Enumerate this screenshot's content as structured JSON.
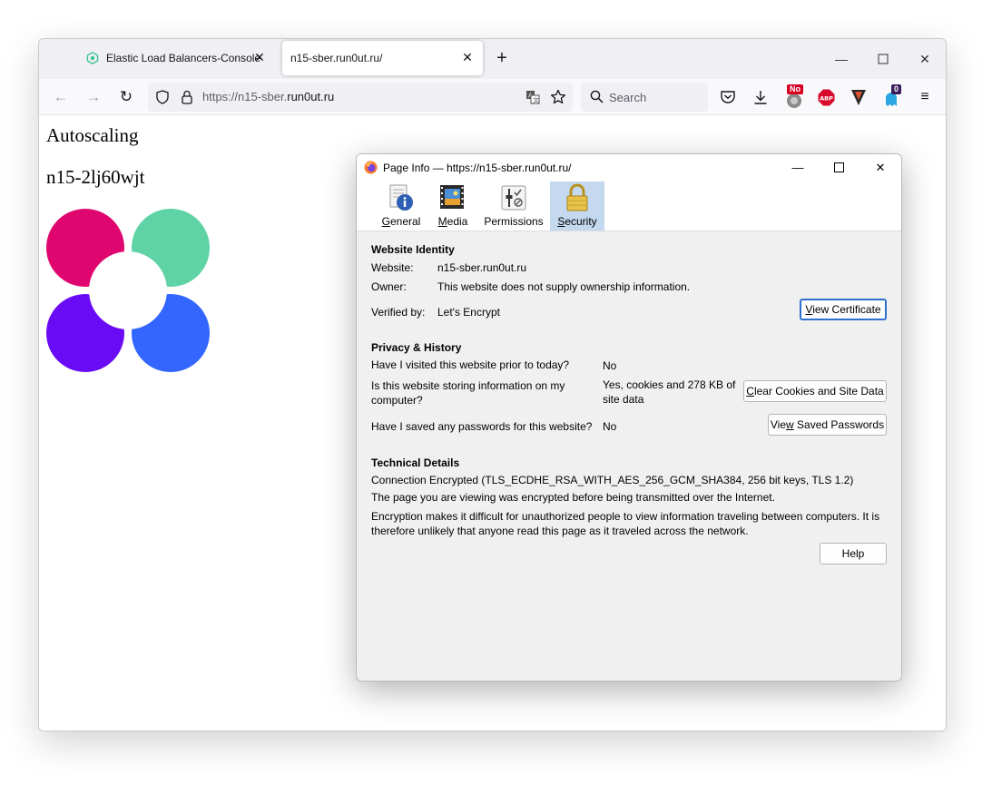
{
  "browser": {
    "tabs": [
      {
        "label": "Elastic Load Balancers-Console"
      },
      {
        "label": "n15-sber.run0ut.ru/"
      }
    ],
    "url_prefix": "https://",
    "url_host_sub": "n15-sber.",
    "url_host_main": "run0ut.ru",
    "search_placeholder": "Search",
    "badges": {
      "no_badge": "No",
      "abp": "ABP",
      "count": "0"
    }
  },
  "page": {
    "heading": "Autoscaling",
    "instance_id": "n15-2lj60wjt",
    "logo_colors": [
      "#e0066f",
      "#5fd3a5",
      "#6a0bf5",
      "#3366ff"
    ]
  },
  "dialog": {
    "title": "Page Info — https://n15-sber.run0ut.ru/",
    "tabs": [
      {
        "accesskey": "G",
        "rest": "eneral"
      },
      {
        "accesskey": "M",
        "rest": "edia"
      },
      {
        "accesskey": "",
        "rest": "Permissions"
      },
      {
        "accesskey": "S",
        "rest": "ecurity"
      }
    ],
    "identity": {
      "heading": "Website Identity",
      "website_label": "Website:",
      "website_value": "n15-sber.run0ut.ru",
      "owner_label": "Owner:",
      "owner_value": "This website does not supply ownership information.",
      "verified_label": "Verified by:",
      "verified_value": "Let's Encrypt",
      "view_cert_pre": "",
      "view_cert_key": "V",
      "view_cert_post": "iew Certificate"
    },
    "privacy": {
      "heading": "Privacy & History",
      "q_visited": "Have I visited this website prior to today?",
      "a_visited": "No",
      "q_storing": "Is this website storing information on my computer?",
      "a_storing": "Yes, cookies and 278 KB of site data",
      "clear_pre": "",
      "clear_key": "C",
      "clear_post": "lear Cookies and Site Data",
      "q_passwords": "Have I saved any passwords for this website?",
      "a_passwords": "No",
      "saved_pre": "Vie",
      "saved_key": "w",
      "saved_post": " Saved Passwords"
    },
    "technical": {
      "heading": "Technical Details",
      "line1": "Connection Encrypted (TLS_ECDHE_RSA_WITH_AES_256_GCM_SHA384, 256 bit keys, TLS 1.2)",
      "line2": "The page you are viewing was encrypted before being transmitted over the Internet.",
      "line3": "Encryption makes it difficult for unauthorized people to view information traveling between computers. It is therefore unlikely that anyone read this page as it traveled across the network."
    },
    "help_label": "Help"
  }
}
